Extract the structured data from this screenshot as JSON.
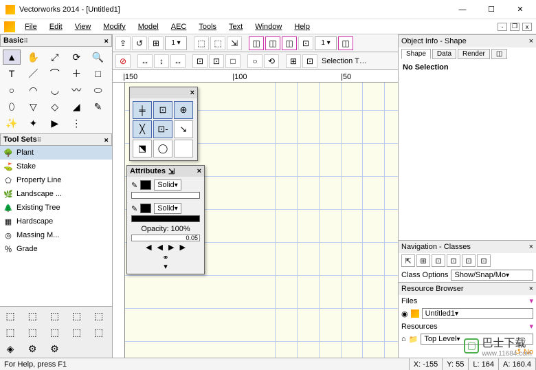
{
  "window": {
    "title": "Vectorworks 2014 - [Untitled1]",
    "min": "—",
    "max": "☐",
    "close": "✕"
  },
  "menu": {
    "items": [
      "File",
      "Edit",
      "View",
      "Modify",
      "Model",
      "AEC",
      "Tools",
      "Text",
      "Window",
      "Help"
    ]
  },
  "mdi": {
    "min": "-",
    "restore": "❐",
    "close": "x"
  },
  "basic": {
    "title": "Basic",
    "tools": [
      "▲",
      "✋",
      "⤢",
      "⟳",
      "🔍",
      "T",
      "／",
      "⌒",
      "＋",
      "□",
      "○",
      "◠",
      "◡",
      "〰",
      "⬭",
      "⬯",
      "▽",
      "◇",
      "◢",
      "✎",
      "✨",
      "✦",
      "▶",
      "⋮"
    ]
  },
  "toolsets": {
    "title": "Tool Sets",
    "items": [
      {
        "icon": "🌳",
        "label": "Plant"
      },
      {
        "icon": "⛳",
        "label": "Stake"
      },
      {
        "icon": "⬠",
        "label": "Property Line"
      },
      {
        "icon": "🌿",
        "label": "Landscape ..."
      },
      {
        "icon": "🌲",
        "label": "Existing Tree"
      },
      {
        "icon": "▦",
        "label": "Hardscape"
      },
      {
        "icon": "◎",
        "label": "Massing M..."
      },
      {
        "icon": "％",
        "label": "Grade"
      }
    ],
    "bottom": [
      "⬚",
      "⬚",
      "⬚",
      "⬚",
      "⬚",
      "⬚",
      "⬚",
      "⬚",
      "⬚",
      "⬚",
      "◈",
      "⚙",
      "⚙",
      "",
      ""
    ]
  },
  "toolbar1": [
    "⇪",
    "↺",
    "⊞",
    "1 ▾",
    "⬚",
    "⬚",
    "⇲",
    "◫",
    "◫",
    "◫",
    "⊡",
    "1 ▾",
    "◫"
  ],
  "toolbar2": {
    "btns": [
      "⊘",
      "↔",
      "↕",
      "↔",
      "⊡",
      "⊡",
      "□",
      "○",
      "⟲",
      "⊞",
      "⊡"
    ],
    "label": "Selection T…"
  },
  "ruler": {
    "t1": "|150",
    "t2": "|100",
    "t3": "|50"
  },
  "snap": {
    "title": "",
    "btns": [
      "╪",
      "⊡",
      "⊕",
      "╳",
      "⊡-",
      "↘",
      "⬔",
      "◯",
      ""
    ]
  },
  "attributes": {
    "title": "Attributes",
    "pin": "⇲",
    "fill_type": "Solid",
    "line_type": "Solid",
    "opacity_label": "Opacity:",
    "opacity_value": "100%",
    "slider_val": "0.05",
    "nav": [
      "◀",
      "◀",
      "▶",
      "▶"
    ],
    "link": "⚭",
    "menu": "▾"
  },
  "objinfo": {
    "title": "Object Info - Shape",
    "tabs": [
      "Shape",
      "Data",
      "Render"
    ],
    "extra": "◫",
    "body": "No Selection"
  },
  "nav": {
    "title": "Navigation - Classes",
    "tb": [
      "⇱",
      "⊞",
      "⊡",
      "⊡",
      "⊡",
      "⊡"
    ],
    "label": "Class Options",
    "value": "Show/Snap/Mo"
  },
  "resbrowser": {
    "title": "Resource Browser",
    "files_label": "Files",
    "file_value": "Untitled1",
    "res_label": "Resources",
    "res_value": "Top Level",
    "bottom": "No"
  },
  "status": {
    "help": "For Help, press F1",
    "x_label": "X:",
    "x_val": "-155",
    "y_label": "Y:",
    "y_val": "55",
    "l_label": "L:",
    "l_val": "164",
    "a_label": "A:",
    "a_val": "160.4"
  },
  "watermark": {
    "cn": "巴士下载",
    "url": "www.11684.com"
  }
}
